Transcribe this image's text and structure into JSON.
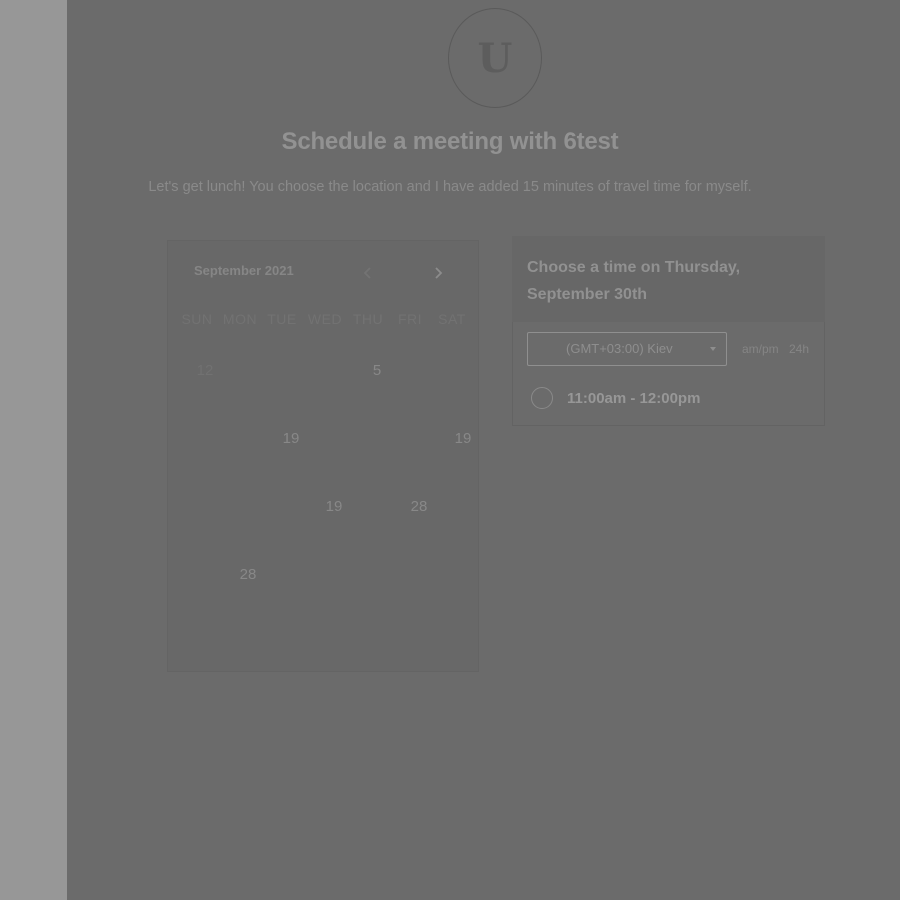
{
  "colors": {
    "overlay": "#6b6b6b",
    "left_strip": "#979797"
  },
  "header": {
    "avatar_letter": "U",
    "title": "Schedule a meeting with 6test",
    "subtitle": "Let's get lunch! You choose the location and I have added 15 minutes of travel time for myself."
  },
  "calendar": {
    "month_label": "September 2021",
    "prev_icon": "chevron-left-icon",
    "next_icon": "chevron-right-icon",
    "weekdays": [
      "SUN",
      "MON",
      "TUE",
      "WED",
      "THU",
      "FRI",
      "SAT"
    ],
    "weeks": [
      [
        "12",
        "",
        "",
        "",
        "5",
        "",
        ""
      ],
      [
        "",
        "",
        "19",
        "",
        "",
        "",
        "19"
      ],
      [
        "",
        "",
        "",
        "19",
        "",
        "28",
        ""
      ],
      [
        "",
        "28",
        "",
        "",
        "",
        "",
        ""
      ],
      [
        "",
        "",
        "",
        "",
        "",
        "",
        ""
      ]
    ]
  },
  "time_panel": {
    "title": "Choose a time on Thursday, September 30th",
    "timezone": "(GMT+03:00) Kiev",
    "format_ampm": "am/pm",
    "format_24h": "24h",
    "slots": [
      "11:00am - 12:00pm"
    ]
  }
}
